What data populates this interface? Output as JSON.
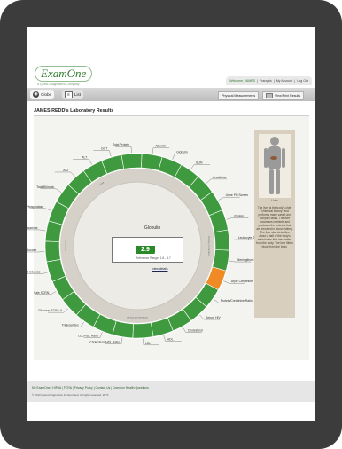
{
  "logo": {
    "brand": "ExamOne",
    "tagline": "A Quest Diagnostics Company"
  },
  "account_bar": {
    "welcome": "Welcome, JAMES",
    "language": "Français",
    "my_account": "My Account",
    "logout": "Log Out",
    "sep": "|"
  },
  "tabs": [
    {
      "label": "Globe",
      "icon": "globe-icon"
    },
    {
      "label": "List",
      "icon": "list-icon"
    }
  ],
  "buttons": {
    "physical": "Physical Measurements",
    "print": "View/Print Results"
  },
  "page_title": "JAMES REDD's Laboratory Results",
  "wheel": {
    "labels": [
      "Total Protein",
      "Albumin",
      "Globulin",
      "BUN",
      "Creatinine",
      "Urine PH Screen",
      "Protein",
      "Leukocyte Screen",
      "Meningitism Screen",
      "Aryte Creatinine",
      "Protein/Creatinine Ratio",
      "Serum HIV",
      "Cholesterol",
      "HDL",
      "LDL",
      "Cholesterol/HDL Ratio",
      "LDL/HDL Ratio",
      "Triglycerides",
      "Glucose: ECRA-II",
      "Sale SCRN",
      "Blood Glucose",
      "Urine Glucose",
      "Fructosamine",
      "Alkaline Phosphatase",
      "Total Bilirubin",
      "AST",
      "ALT",
      "GGT"
    ],
    "inner_labels": [
      "Liver",
      "Kidney Function",
      "Cholesterol Panel",
      "Glucose"
    ],
    "flagged_index": 9,
    "colors": {
      "normal": "#3f9a3f",
      "flagged": "#f08a24",
      "inner_ring": "#d5d1c8",
      "fill": "#ecebe6"
    }
  },
  "center": {
    "name": "Globulin",
    "value": "2.9",
    "unit": "g/dL",
    "reference": "Reference Range: 1.8 - 3.7",
    "details": "view details"
  },
  "body_panel": {
    "label": "Liver",
    "description": "The liver is the body's chief \"chemical factory\" and performs many varied and complex tasks. The liver processes nutrients and produces the proteins that are involved in blood clotting. The liver also detoxifies about a half of the body's main toxins that are carried from the body. The liver filters blood from the body."
  },
  "footer": {
    "links": [
      "My ExamOne",
      "HIPAA",
      "FCRA",
      "Privacy Policy",
      "Contact Us",
      "Common Health Questions"
    ],
    "copyright": "© 2013 Quest Diagnostics Incorporated. All rights reserved. 2073"
  }
}
